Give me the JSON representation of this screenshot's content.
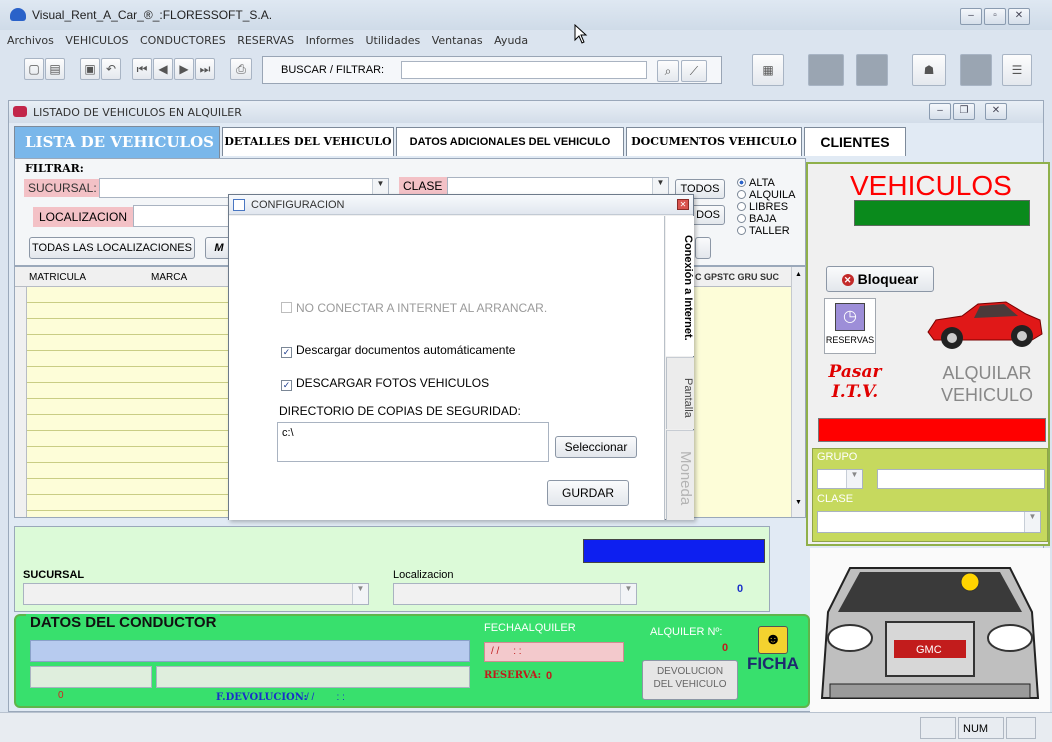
{
  "app": {
    "title": "Visual_Rent_A_Car_®_:FLORESSOFT_S.A.",
    "menu": [
      "Archivos",
      "VEHICULOS",
      "CONDUCTORES",
      "RESERVAS",
      "Informes",
      "Utilidades",
      "Ventanas",
      "Ayuda"
    ],
    "search_label": "BUSCAR / FILTRAR:"
  },
  "child": {
    "title": "LISTADO DE VEHICULOS EN ALQUILER",
    "tabs": {
      "lista": "LISTA DE VEHICULOS",
      "detalles": "DETALLES DEL VEHICULO",
      "datos": "DATOS ADICIONALES DEL VEHICULO",
      "documentos": "DOCUMENTOS VEHICULO",
      "clientes": "CLIENTES"
    }
  },
  "filter": {
    "title": "FILTRAR:",
    "sucursal": "SUCURSAL:",
    "clase": "CLASE",
    "todos": "TODOS",
    "todos2": "DOS",
    "localizacion": "LOCALIZACION",
    "todas_loc": "TODAS LAS LOCALIZACIONES",
    "m_label": "M",
    "status": [
      "ALTA",
      "ALQUILA",
      "LIBRES",
      "BAJA",
      "TALLER"
    ],
    "columns": {
      "matricula": "MATRICULA",
      "marca": "MARCA",
      "right": "C  GPSTC GRU SUC"
    }
  },
  "right_panel": {
    "vehiculos": "VEHICULOS",
    "bloquear": "Bloquear",
    "reservas": "RESERVAS",
    "pasar_itv_1": "Pasar",
    "pasar_itv_2": "I.T.V.",
    "alquilar_1": "ALQUILAR",
    "alquilar_2": "VEHICULO",
    "grupo": "GRUPO",
    "clase": "CLASE",
    "colors": {
      "green_bar": "#0a8a1c",
      "red_bar": "#ff0000",
      "vehiculos_text": "#ff0000"
    }
  },
  "bottom": {
    "sucursal": "SUCURSAL",
    "localizacion": "Localizacion",
    "count": "0",
    "conductor_title": "DATOS DEL CONDUCTOR",
    "fecha_alquiler": "FECHAALQUILER",
    "fecha_value": "/ /     : :",
    "alquiler_n": "ALQUILER Nº:",
    "alquiler_value": "0",
    "reserva": "RESERVA:",
    "reserva_value": "0",
    "devolucion_1": "DEVOLUCION",
    "devolucion_2": "DEL VEHICULO",
    "ficha": "FICHA",
    "zero_left": "0",
    "f_devolucion": "F.DEVOLUCION:",
    "f_devolucion_value": "/ /        : :"
  },
  "dialog": {
    "title": "CONFIGURACION",
    "no_conectar": "NO CONECTAR A INTERNET AL ARRANCAR.",
    "descargar_docs": "Descargar documentos automáticamente",
    "descargar_fotos": "DESCARGAR FOTOS VEHICULOS",
    "directorio": "DIRECTORIO DE COPIAS DE SEGURIDAD:",
    "dir_value": "c:\\",
    "seleccionar": "Seleccionar",
    "guardar": "GURDAR",
    "tabs": {
      "conexion": "Conexión a Internet.",
      "pantalla": "Pantalla",
      "moneda": "Moneda"
    }
  },
  "status_bar": {
    "num": "NUM"
  }
}
